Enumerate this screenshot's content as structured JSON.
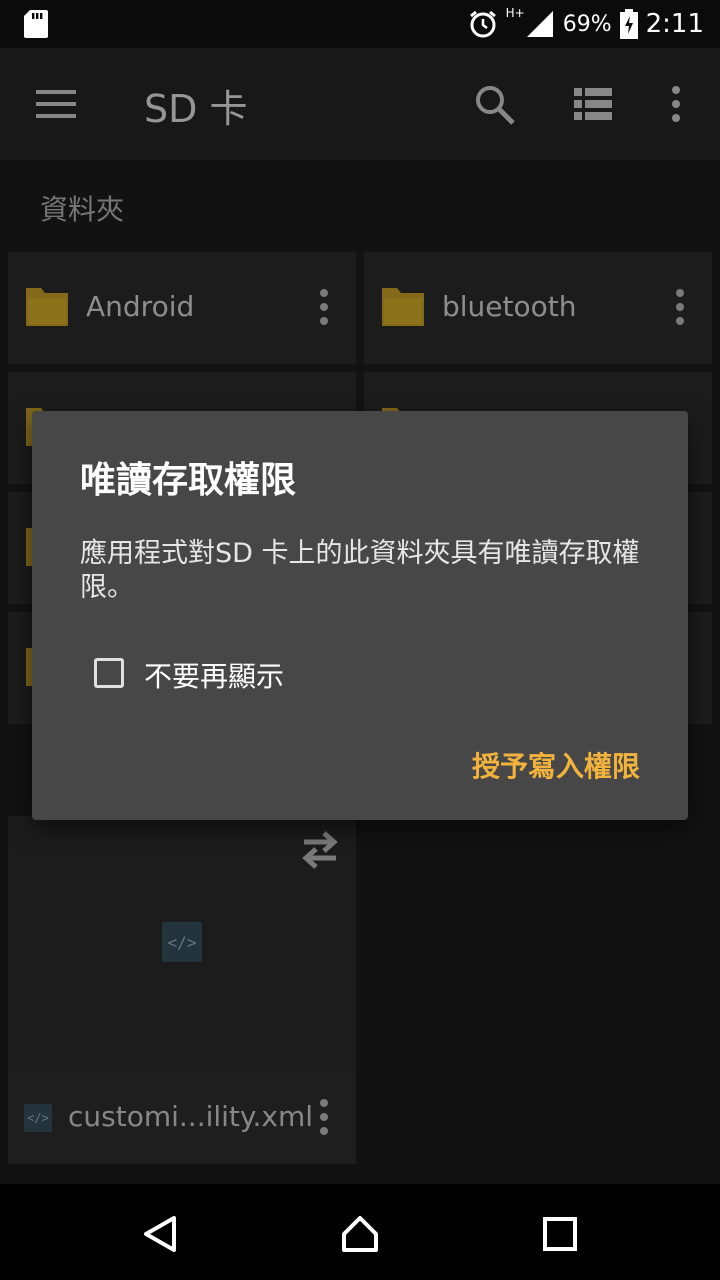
{
  "status_bar": {
    "network": "H+",
    "battery": "69%",
    "time": "2:11"
  },
  "toolbar": {
    "title": "SD 卡"
  },
  "section": {
    "label": "資料夾"
  },
  "folders": [
    {
      "name": "Android"
    },
    {
      "name": "bluetooth"
    }
  ],
  "file_card": {
    "thumb_symbol": "</>",
    "file_name": "customi...ility.xml"
  },
  "dialog": {
    "title": "唯讀存取權限",
    "message": "應用程式對SD 卡上的此資料夾具有唯讀存取權限。",
    "checkbox_label": "不要再顯示",
    "checkbox_checked": false,
    "action_label": "授予寫入權限"
  },
  "colors": {
    "accent": "#f2b33d",
    "folder": "#c9a227",
    "dialog_bg": "#474747"
  }
}
